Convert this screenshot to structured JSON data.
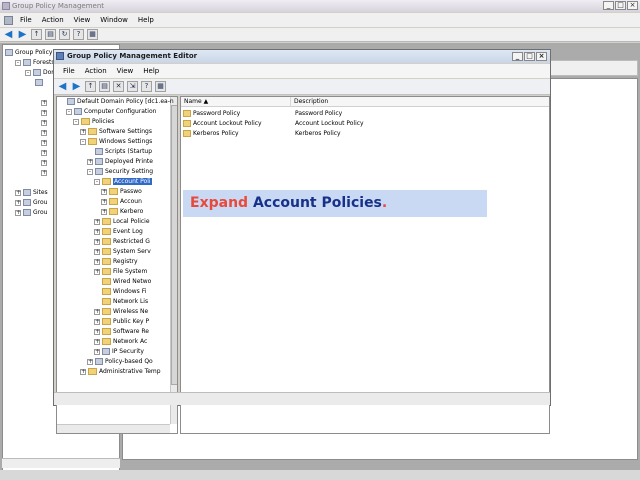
{
  "outer": {
    "title": "Group Policy Management",
    "menu": [
      "File",
      "Action",
      "View",
      "Window",
      "Help"
    ],
    "tree": [
      {
        "label": "Group Policy",
        "indent": 0,
        "expander": "",
        "icon": "obj"
      },
      {
        "label": "Forests",
        "indent": 1,
        "expander": "-",
        "icon": "obj"
      },
      {
        "label": "Dom",
        "indent": 2,
        "expander": "-",
        "icon": "obj"
      },
      {
        "label": "",
        "indent": 3,
        "expander": "",
        "icon": "obj"
      },
      {
        "label": "Sites",
        "indent": 1,
        "expander": "+",
        "icon": "obj"
      },
      {
        "label": "Grou",
        "indent": 1,
        "expander": "+",
        "icon": "obj"
      },
      {
        "label": "Grou",
        "indent": 1,
        "expander": "+",
        "icon": "obj"
      }
    ]
  },
  "editor": {
    "title": "Group Policy Management Editor",
    "menu": [
      "File",
      "Action",
      "View",
      "Help"
    ],
    "tree": [
      {
        "label": "Default Domain Policy [dc1.ea-n",
        "indent": 0,
        "expander": "",
        "icon": "obj"
      },
      {
        "label": "Computer Configuration",
        "indent": 1,
        "expander": "-",
        "icon": "obj"
      },
      {
        "label": "Policies",
        "indent": 2,
        "expander": "-",
        "icon": "fold"
      },
      {
        "label": "Software Settings",
        "indent": 3,
        "expander": "+",
        "icon": "fold"
      },
      {
        "label": "Windows Settings",
        "indent": 3,
        "expander": "-",
        "icon": "fold"
      },
      {
        "label": "Scripts (Startup",
        "indent": 4,
        "expander": "",
        "icon": "obj"
      },
      {
        "label": "Deployed Printe",
        "indent": 4,
        "expander": "+",
        "icon": "obj"
      },
      {
        "label": "Security Setting",
        "indent": 4,
        "expander": "-",
        "icon": "obj"
      },
      {
        "label": "Account Poli",
        "indent": 5,
        "expander": "-",
        "icon": "fold",
        "selected": true
      },
      {
        "label": "Passwo",
        "indent": 6,
        "expander": "+",
        "icon": "fold"
      },
      {
        "label": "Accoun",
        "indent": 6,
        "expander": "+",
        "icon": "fold"
      },
      {
        "label": "Kerbero",
        "indent": 6,
        "expander": "+",
        "icon": "fold"
      },
      {
        "label": "Local Policie",
        "indent": 5,
        "expander": "+",
        "icon": "fold"
      },
      {
        "label": "Event Log",
        "indent": 5,
        "expander": "+",
        "icon": "fold"
      },
      {
        "label": "Restricted G",
        "indent": 5,
        "expander": "+",
        "icon": "fold"
      },
      {
        "label": "System Serv",
        "indent": 5,
        "expander": "+",
        "icon": "fold"
      },
      {
        "label": "Registry",
        "indent": 5,
        "expander": "+",
        "icon": "fold"
      },
      {
        "label": "File System",
        "indent": 5,
        "expander": "+",
        "icon": "fold"
      },
      {
        "label": "Wired Netwo",
        "indent": 5,
        "expander": "",
        "icon": "fold"
      },
      {
        "label": "Windows Fi",
        "indent": 5,
        "expander": "",
        "icon": "fold"
      },
      {
        "label": "Network Lis",
        "indent": 5,
        "expander": "",
        "icon": "fold"
      },
      {
        "label": "Wireless Ne",
        "indent": 5,
        "expander": "+",
        "icon": "fold"
      },
      {
        "label": "Public Key P",
        "indent": 5,
        "expander": "+",
        "icon": "fold"
      },
      {
        "label": "Software Re",
        "indent": 5,
        "expander": "+",
        "icon": "fold"
      },
      {
        "label": "Network Ac",
        "indent": 5,
        "expander": "+",
        "icon": "fold"
      },
      {
        "label": "IP Security",
        "indent": 5,
        "expander": "+",
        "icon": "obj"
      },
      {
        "label": "Policy-based Qo",
        "indent": 4,
        "expander": "+",
        "icon": "obj"
      },
      {
        "label": "Administrative Temp",
        "indent": 3,
        "expander": "+",
        "icon": "fold"
      }
    ],
    "columns": {
      "name": "Name",
      "description": "Description"
    },
    "rows": [
      {
        "name": "Password Policy",
        "description": "Password Policy"
      },
      {
        "name": "Account Lockout Policy",
        "description": "Account Lockout Policy"
      },
      {
        "name": "Kerberos Policy",
        "description": "Kerberos Policy"
      }
    ]
  },
  "annotation": {
    "part1": "Expand ",
    "part2": "Account Policies",
    "part3": "."
  }
}
